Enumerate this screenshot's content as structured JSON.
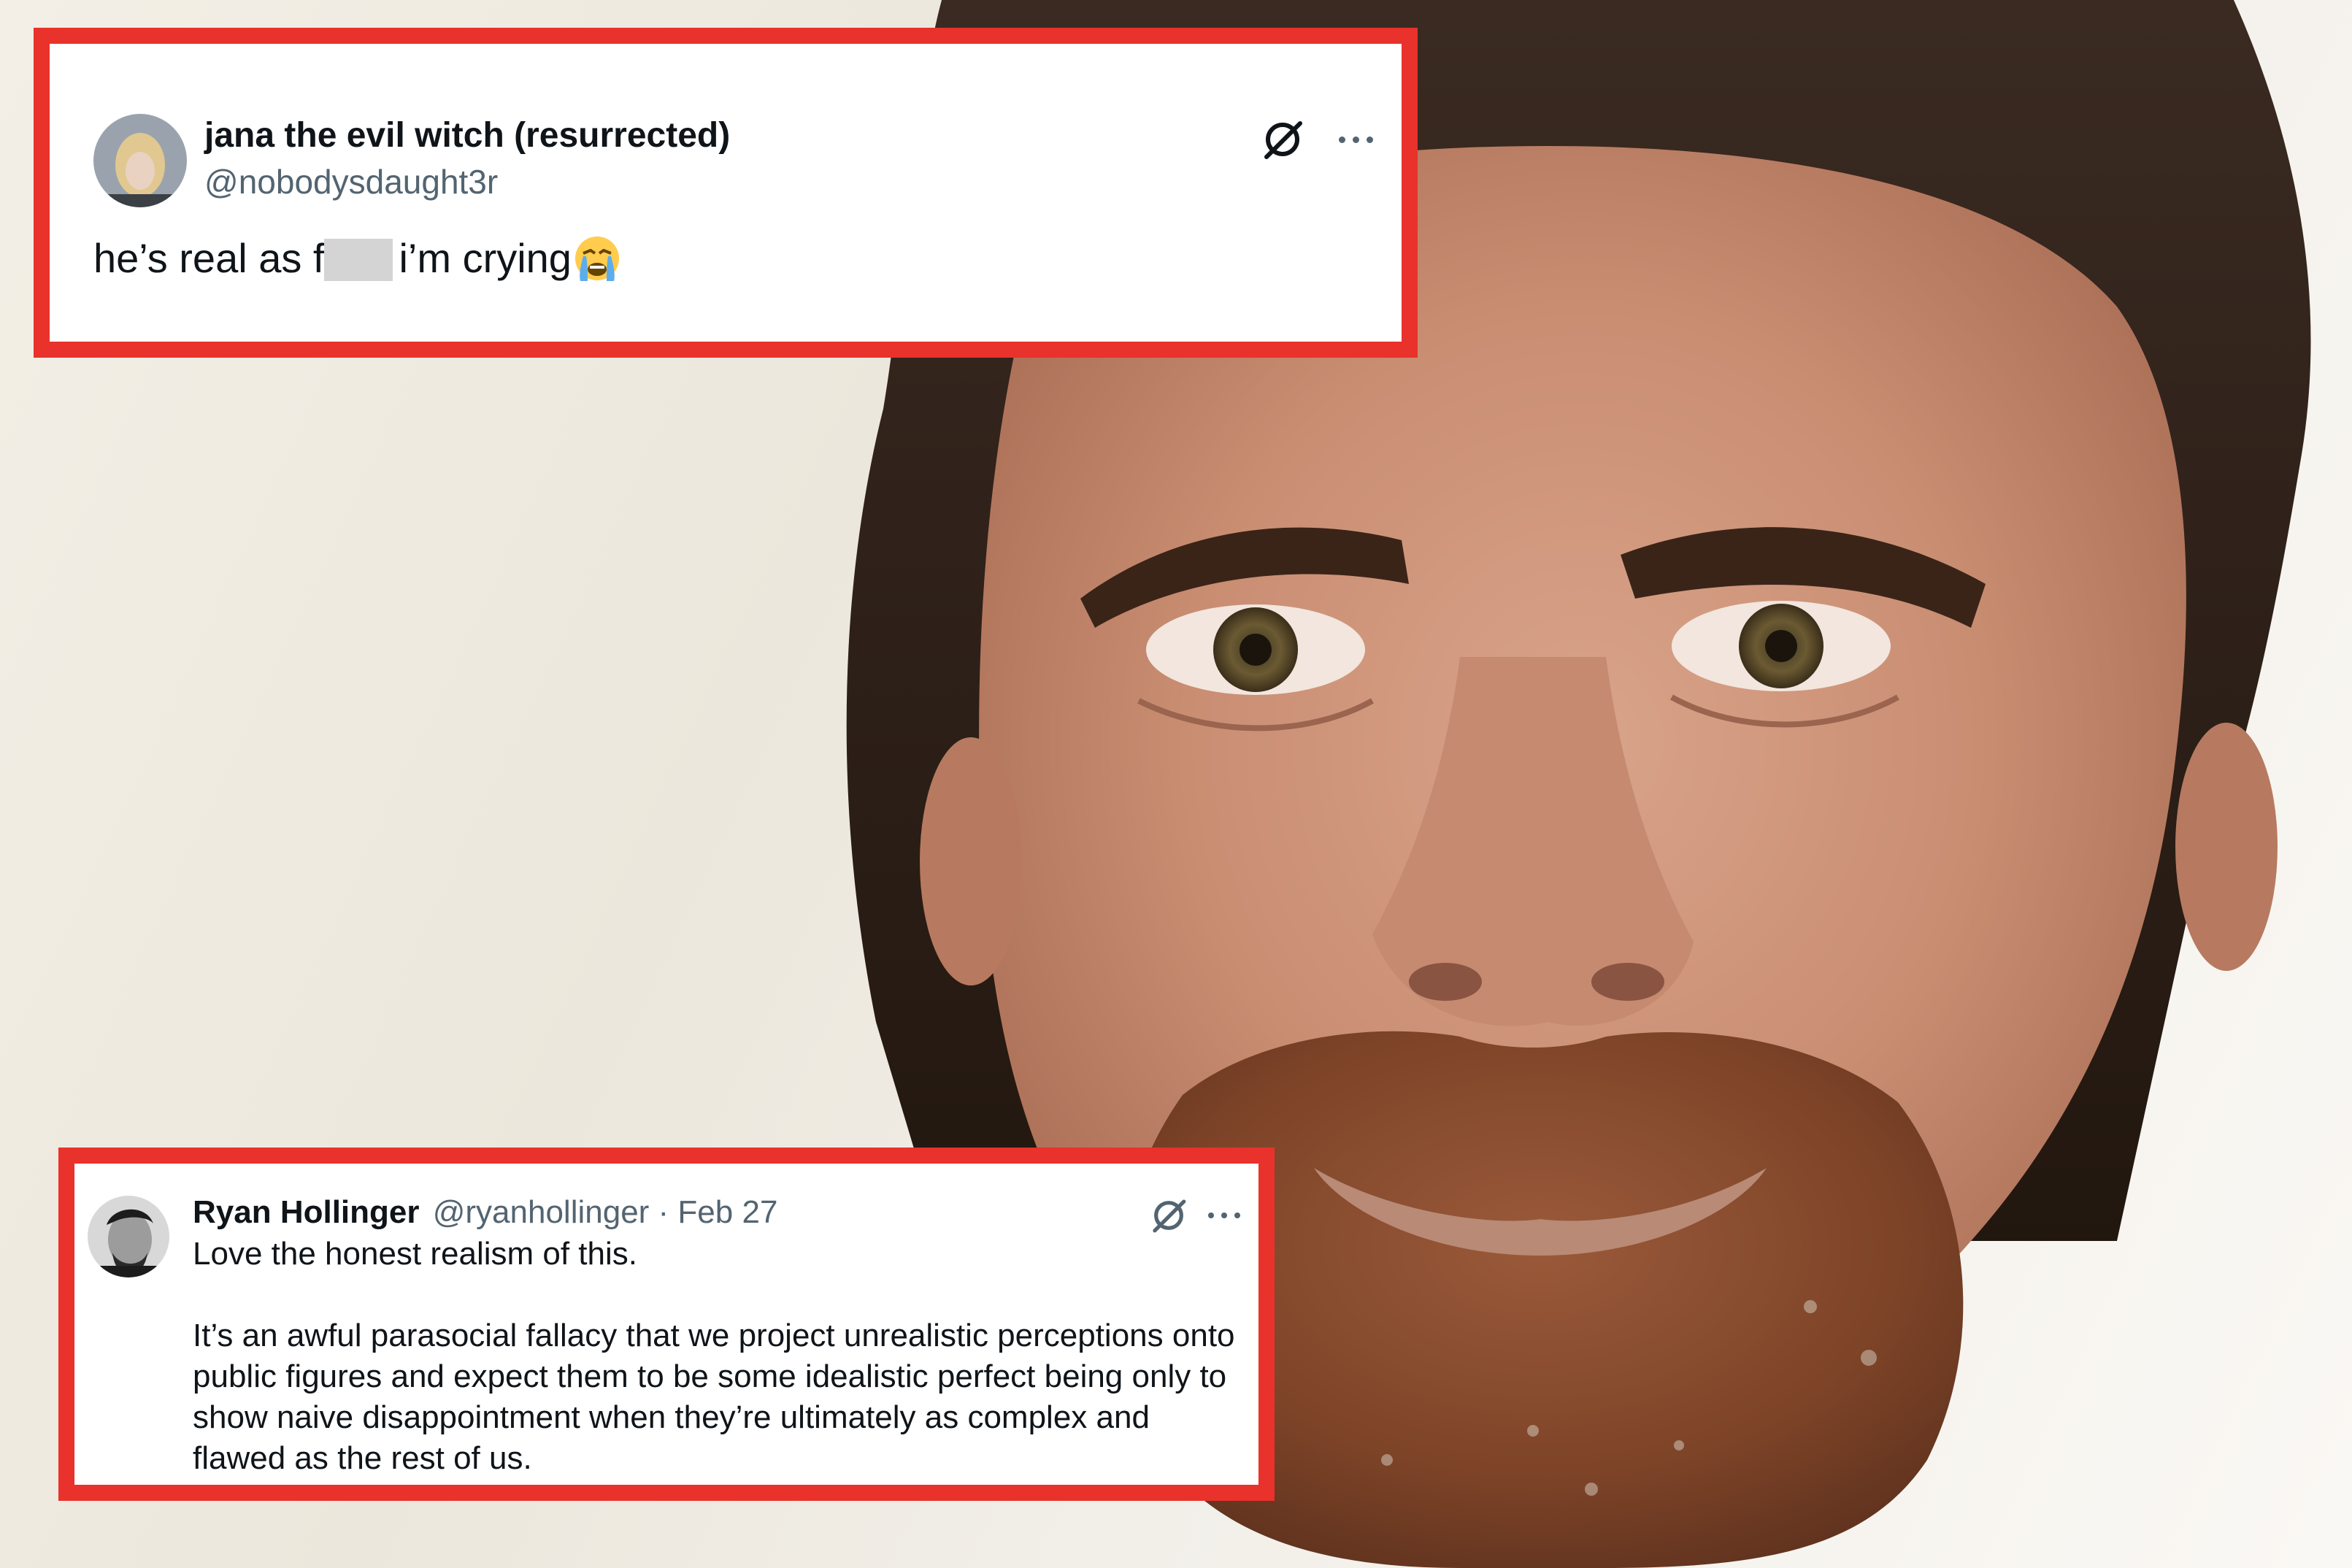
{
  "tweet_top": {
    "display_name": "jana the evil witch (resurrected)",
    "handle": "@nobodysdaught3r",
    "text_before": "he’s real as f",
    "text_after": "i’m crying",
    "emoji": "loudly-crying-face-icon"
  },
  "tweet_bottom": {
    "display_name": "Ryan Hollinger",
    "handle_date": "@ryanhollinger · Feb 27",
    "line1": "Love the honest realism of this.",
    "paragraph2": "It’s an awful parasocial fallacy that we project unrealistic perceptions onto public figures and expect them to be some idealistic perfect being only to show naive disappointment when they’re ultimately as complex and flawed as the rest of us."
  },
  "colors": {
    "frame_red": "#e8322b",
    "name_text": "#0f1419",
    "handle_text": "#536471"
  }
}
